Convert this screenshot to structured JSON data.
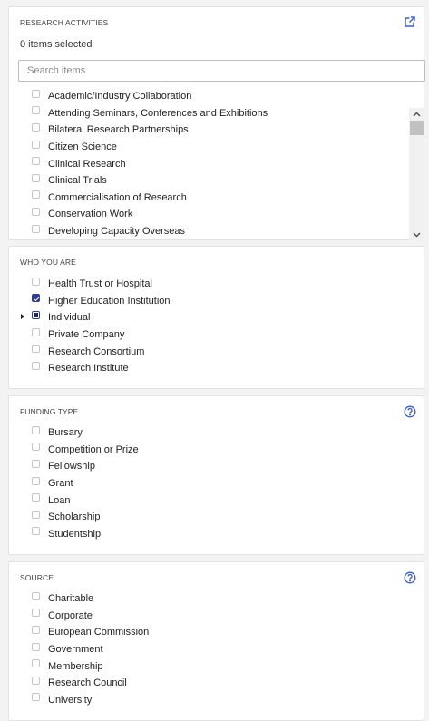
{
  "research_activities": {
    "title": "RESEARCH ACTIVITIES",
    "subtext": "0 items selected",
    "search_placeholder": "Search items",
    "items": [
      {
        "label": "Academic/Industry Collaboration",
        "checked": false
      },
      {
        "label": "Attending Seminars, Conferences and Exhibitions",
        "checked": false
      },
      {
        "label": "Bilateral Research Partnerships",
        "checked": false
      },
      {
        "label": "Citizen Science",
        "checked": false
      },
      {
        "label": "Clinical Research",
        "checked": false
      },
      {
        "label": "Clinical Trials",
        "checked": false
      },
      {
        "label": "Commercialisation of Research",
        "checked": false
      },
      {
        "label": "Conservation Work",
        "checked": false
      },
      {
        "label": "Developing Capacity Overseas",
        "checked": false
      }
    ],
    "icon": "external-edit-icon"
  },
  "who_you_are": {
    "title": "WHO YOU ARE",
    "items": [
      {
        "label": "Health Trust or Hospital",
        "state": "unchecked"
      },
      {
        "label": "Higher Education Institution",
        "state": "checked"
      },
      {
        "label": "Individual",
        "state": "indeterminate"
      },
      {
        "label": "Private Company",
        "state": "unchecked"
      },
      {
        "label": "Research Consortium",
        "state": "unchecked"
      },
      {
        "label": "Research Institute",
        "state": "unchecked"
      }
    ]
  },
  "funding_type": {
    "title": "FUNDING TYPE",
    "items": [
      "Bursary",
      "Competition or Prize",
      "Fellowship",
      "Grant",
      "Loan",
      "Scholarship",
      "Studentship"
    ],
    "icon": "help-circle-icon"
  },
  "source": {
    "title": "SOURCE",
    "items": [
      "Charitable",
      "Corporate",
      "European Commission",
      "Government",
      "Membership",
      "Research Council",
      "University"
    ],
    "icon": "help-circle-icon"
  },
  "colors": {
    "accent": "#3b5bdb",
    "checkbox_checked": "#2f3b9c",
    "panel_bg": "#ffffff",
    "page_bg": "#f3f3f3"
  }
}
